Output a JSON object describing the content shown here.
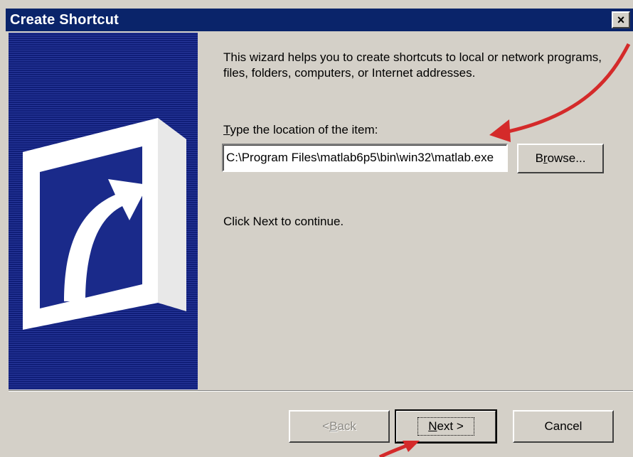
{
  "window": {
    "title": "Create Shortcut",
    "close_label": "×"
  },
  "content": {
    "intro": "This wizard helps you to create shortcuts to local or network programs, files, folders, computers, or Internet addresses.",
    "location_label_accesskey": "T",
    "location_label_rest": "ype the location of the item:",
    "location_value": "C:\\Program Files\\matlab6p5\\bin\\win32\\matlab.exe",
    "browse_accesskey": "r",
    "browse_pre": "B",
    "browse_post": "owse...",
    "continue_text": "Click Next to continue."
  },
  "footer": {
    "back_pre": "< ",
    "back_accesskey": "B",
    "back_post": "ack",
    "next_accesskey": "N",
    "next_post": "ext >",
    "cancel_label": "Cancel"
  },
  "colors": {
    "titlebar": "#0a246a",
    "panel": "#1a2a8a",
    "annotation_arrow": "#d42a2a",
    "dialog_bg": "#d4d0c8"
  },
  "icons": {
    "side_panel": "shortcut-arrow-icon"
  }
}
